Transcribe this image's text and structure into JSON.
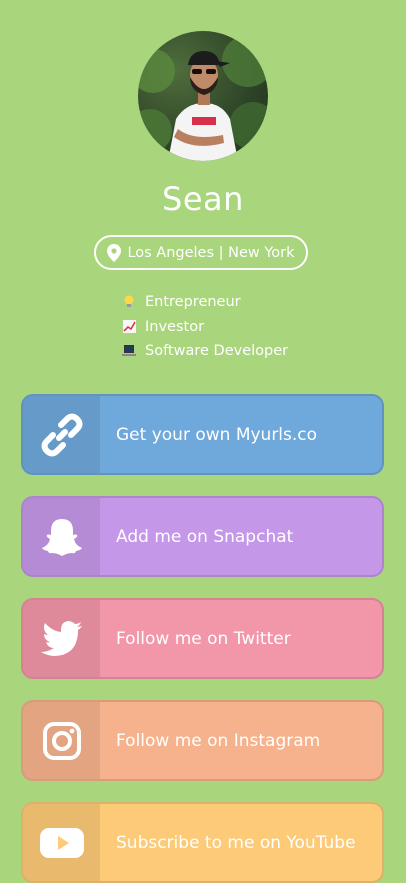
{
  "profile": {
    "name": "Sean",
    "location": "Los Angeles | New York",
    "bio": [
      {
        "icon": "lightbulb-icon",
        "text": "Entrepreneur"
      },
      {
        "icon": "chart-increasing-icon",
        "text": "Investor"
      },
      {
        "icon": "laptop-icon",
        "text": "Software Developer"
      }
    ]
  },
  "links": [
    {
      "label": "Get your own Myurls.co",
      "icon": "link-icon",
      "color": "#6fa8db"
    },
    {
      "label": "Add me on Snapchat",
      "icon": "snapchat-icon",
      "color": "#c597e8"
    },
    {
      "label": "Follow me on Twitter",
      "icon": "twitter-icon",
      "color": "#f296a9"
    },
    {
      "label": "Follow me on Instagram",
      "icon": "instagram-icon",
      "color": "#f6b28c"
    },
    {
      "label": "Subscribe to me on YouTube",
      "icon": "youtube-icon",
      "color": "#fdca77"
    }
  ],
  "theme": {
    "background": "#a9d57d"
  }
}
